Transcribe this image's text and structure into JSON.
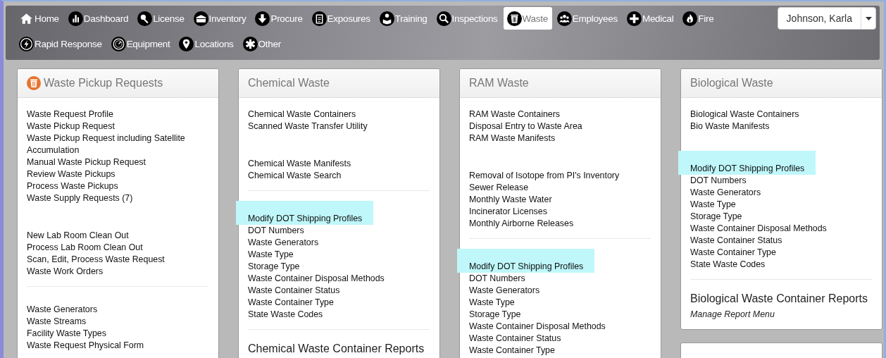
{
  "nav": {
    "items": [
      {
        "label": "Home",
        "selected": false
      },
      {
        "label": "Dashboard",
        "selected": false
      },
      {
        "label": "License",
        "selected": false
      },
      {
        "label": "Inventory",
        "selected": false
      },
      {
        "label": "Procure",
        "selected": false
      },
      {
        "label": "Exposures",
        "selected": false
      },
      {
        "label": "Training",
        "selected": false
      },
      {
        "label": "Inspections",
        "selected": false
      },
      {
        "label": "Waste",
        "selected": true
      },
      {
        "label": "Employees",
        "selected": false
      },
      {
        "label": "Medical",
        "selected": false
      },
      {
        "label": "Fire",
        "selected": false
      },
      {
        "label": "Rapid Response",
        "selected": false
      },
      {
        "label": "Equipment",
        "selected": false
      },
      {
        "label": "Locations",
        "selected": false
      },
      {
        "label": "Other",
        "selected": false
      }
    ],
    "user": "Johnson, Karla"
  },
  "columns": [
    {
      "panels": [
        {
          "kind": "panel",
          "title": "Waste Pickup Requests",
          "sections": [
            {
              "kind": "links",
              "items": [
                {
                  "label": "Waste Request Profile",
                  "highlighted": false
                },
                {
                  "label": "Waste Pickup Request",
                  "highlighted": false
                },
                {
                  "label": "Waste Pickup Request including Satellite Accumulation",
                  "highlighted": false
                },
                {
                  "label": "Manual Waste Pickup Request",
                  "highlighted": false
                },
                {
                  "label": "Review Waste Pickups",
                  "highlighted": false
                },
                {
                  "label": "Process Waste Pickups",
                  "highlighted": false
                },
                {
                  "label": "Waste Supply Requests (7)",
                  "highlighted": false
                }
              ]
            },
            {
              "kind": "gap"
            },
            {
              "kind": "links",
              "items": [
                {
                  "label": "New Lab Room Clean Out",
                  "highlighted": false
                },
                {
                  "label": "Process Lab Room Clean Out",
                  "highlighted": false
                },
                {
                  "label": "Scan, Edit, Process Waste Request",
                  "highlighted": false
                },
                {
                  "label": "Waste Work Orders",
                  "highlighted": false
                }
              ]
            },
            {
              "kind": "divider"
            },
            {
              "kind": "links",
              "items": [
                {
                  "label": "Waste Generators",
                  "highlighted": false
                },
                {
                  "label": "Waste Streams",
                  "highlighted": false
                },
                {
                  "label": "Facility Waste Types",
                  "highlighted": false
                },
                {
                  "label": "Waste Request Physical Form",
                  "highlighted": false
                }
              ]
            }
          ]
        }
      ]
    },
    {
      "panels": [
        {
          "kind": "panel",
          "title": "Chemical Waste",
          "sections": [
            {
              "kind": "links",
              "items": [
                {
                  "label": "Chemical Waste Containers",
                  "highlighted": false
                },
                {
                  "label": "Scanned Waste Transfer Utility",
                  "highlighted": false
                }
              ]
            },
            {
              "kind": "gap"
            },
            {
              "kind": "links",
              "items": [
                {
                  "label": "Chemical Waste Manifests",
                  "highlighted": false
                },
                {
                  "label": "Chemical Waste Search",
                  "highlighted": false
                }
              ]
            },
            {
              "kind": "divider"
            },
            {
              "kind": "links",
              "items": [
                {
                  "label": "Modify DOT Shipping Profiles",
                  "highlighted": true
                },
                {
                  "label": "DOT Numbers",
                  "highlighted": false
                },
                {
                  "label": "Waste Generators",
                  "highlighted": false
                },
                {
                  "label": "Waste Type",
                  "highlighted": false
                },
                {
                  "label": "Storage Type",
                  "highlighted": false
                },
                {
                  "label": "Waste Container Disposal Methods",
                  "highlighted": false
                },
                {
                  "label": "Waste Container Status",
                  "highlighted": false
                },
                {
                  "label": "Waste Container Type",
                  "highlighted": false
                },
                {
                  "label": "State Waste Codes",
                  "highlighted": false
                }
              ]
            },
            {
              "kind": "divider"
            },
            {
              "kind": "heading",
              "text": "Chemical Waste Container Reports"
            }
          ]
        }
      ]
    },
    {
      "panels": [
        {
          "kind": "panel",
          "title": "RAM Waste",
          "sections": [
            {
              "kind": "links",
              "items": [
                {
                  "label": "RAM Waste Containers",
                  "highlighted": false
                },
                {
                  "label": "Disposal Entry to Waste Area",
                  "highlighted": false
                },
                {
                  "label": "RAM Waste Manifests",
                  "highlighted": false
                }
              ]
            },
            {
              "kind": "gap"
            },
            {
              "kind": "links",
              "items": [
                {
                  "label": "Removal of Isotope from PI's Inventory",
                  "highlighted": false
                },
                {
                  "label": "Sewer Release",
                  "highlighted": false
                },
                {
                  "label": "Monthly Waste Water",
                  "highlighted": false
                },
                {
                  "label": "Incinerator Licenses",
                  "highlighted": false
                },
                {
                  "label": "Monthly Airborne Releases",
                  "highlighted": false
                }
              ]
            },
            {
              "kind": "divider"
            },
            {
              "kind": "links",
              "items": [
                {
                  "label": "Modify DOT Shipping Profiles",
                  "highlighted": true
                },
                {
                  "label": "DOT Numbers",
                  "highlighted": false
                },
                {
                  "label": "Waste Generators",
                  "highlighted": false
                },
                {
                  "label": "Waste Type",
                  "highlighted": false
                },
                {
                  "label": "Storage Type",
                  "highlighted": false
                },
                {
                  "label": "Waste Container Disposal Methods",
                  "highlighted": false
                },
                {
                  "label": "Waste Container Status",
                  "highlighted": false
                },
                {
                  "label": "Waste Container Type",
                  "highlighted": false
                }
              ]
            }
          ]
        }
      ]
    },
    {
      "panels": [
        {
          "kind": "panel",
          "title": "Biological Waste",
          "sections": [
            {
              "kind": "links",
              "items": [
                {
                  "label": "Biological Waste Containers",
                  "highlighted": false
                },
                {
                  "label": "Bio Waste Manifests",
                  "highlighted": false
                }
              ]
            },
            {
              "kind": "gap"
            },
            {
              "kind": "links",
              "items": [
                {
                  "label": "Modify DOT Shipping Profiles",
                  "highlighted": true
                },
                {
                  "label": "DOT Numbers",
                  "highlighted": false
                },
                {
                  "label": "Waste Generators",
                  "highlighted": false
                },
                {
                  "label": "Waste Type",
                  "highlighted": false
                },
                {
                  "label": "Storage Type",
                  "highlighted": false
                },
                {
                  "label": "Waste Container Disposal Methods",
                  "highlighted": false
                },
                {
                  "label": "Waste Container Status",
                  "highlighted": false
                },
                {
                  "label": "Waste Container Type",
                  "highlighted": false
                },
                {
                  "label": "State Waste Codes",
                  "highlighted": false
                }
              ]
            },
            {
              "kind": "divider"
            },
            {
              "kind": "heading",
              "text": "Biological Waste Container Reports"
            },
            {
              "kind": "report_link",
              "text": "Manage Report Menu"
            }
          ]
        },
        {
          "kind": "empty"
        }
      ]
    }
  ]
}
